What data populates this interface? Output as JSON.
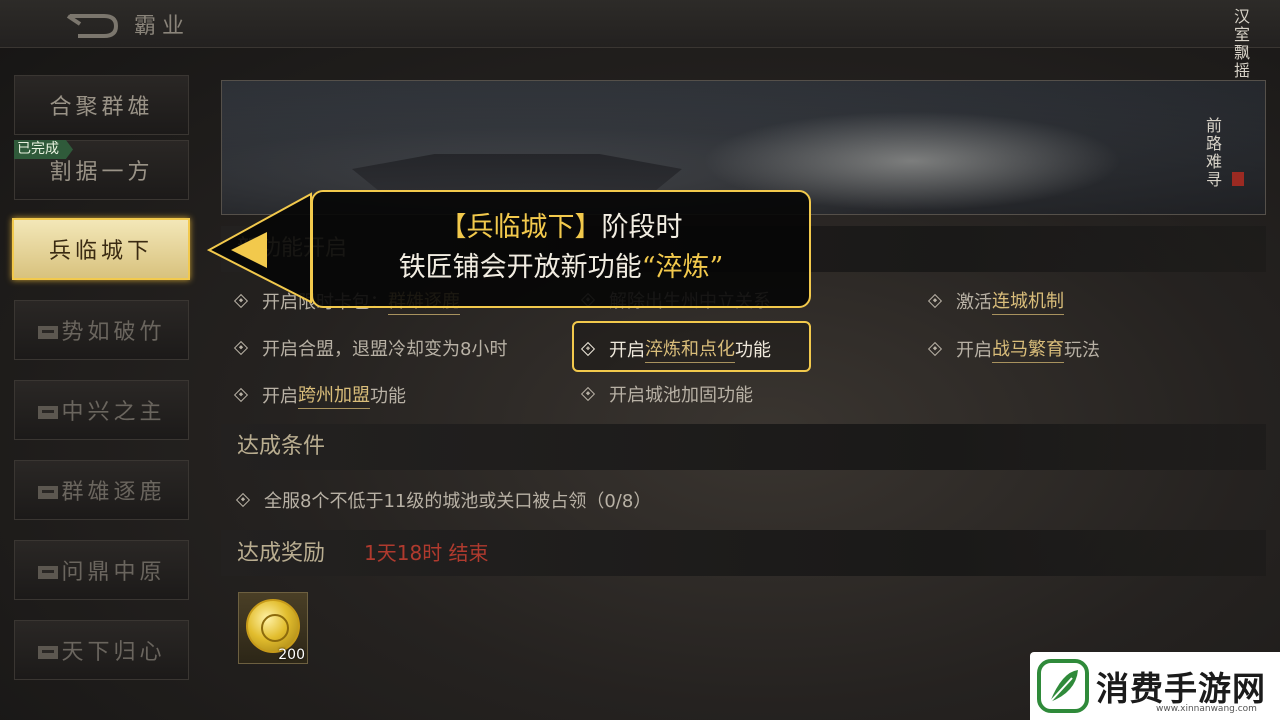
{
  "header": {
    "title": "霸业"
  },
  "menu": [
    {
      "label": "合聚群雄",
      "state": "normal"
    },
    {
      "label": "割据一方",
      "state": "completed",
      "tag": "已完成"
    },
    {
      "label": "兵临城下",
      "state": "active"
    },
    {
      "label": "势如破竹",
      "state": "locked"
    },
    {
      "label": "中兴之主",
      "state": "locked"
    },
    {
      "label": "群雄逐鹿",
      "state": "locked"
    },
    {
      "label": "问鼎中原",
      "state": "locked"
    },
    {
      "label": "天下归心",
      "state": "locked"
    }
  ],
  "banner": {
    "poem_col1": "汉室飘摇",
    "poem_col2": "前路难寻"
  },
  "features": {
    "title": "新功能开启",
    "items": [
      {
        "prefix": "开启限时卡包：",
        "highlight": "群雄逐鹿",
        "suffix": ""
      },
      {
        "prefix": "解除出生州中立关系",
        "highlight": "",
        "suffix": ""
      },
      {
        "prefix": "激活",
        "highlight": "连城机制",
        "suffix": ""
      },
      {
        "prefix": "开启合盟，退盟冷却变为8小时",
        "highlight": "",
        "suffix": ""
      },
      {
        "prefix": "开启",
        "highlight": "淬炼和点化",
        "suffix": "功能"
      },
      {
        "prefix": "开启",
        "highlight": "战马繁育",
        "suffix": "玩法"
      },
      {
        "prefix": "开启",
        "highlight": "跨州加盟",
        "suffix": "功能"
      },
      {
        "prefix": "开启城池加固功能",
        "highlight": "",
        "suffix": ""
      }
    ]
  },
  "conditions": {
    "title": "达成条件",
    "items": [
      {
        "text": "全服8个不低于11级的城池或关口被占领（0/8）"
      }
    ]
  },
  "rewards": {
    "title": "达成奖励",
    "timer": "1天18时 结束",
    "items": [
      {
        "count": "200",
        "icon": "gold-coin-icon"
      }
    ]
  },
  "tooltip": {
    "line1_highlight": "【兵临城下】",
    "line1_rest": "阶段时",
    "line2_rest": "铁匠铺会开放新功能",
    "line2_highlight": "“淬炼”"
  },
  "watermark": {
    "name": "消费手游网",
    "url": "www.xinnanwang.com"
  },
  "colors": {
    "accent": "#f2c94c",
    "timer": "#b03a2e",
    "highlight_text": "#d9bd7a"
  }
}
